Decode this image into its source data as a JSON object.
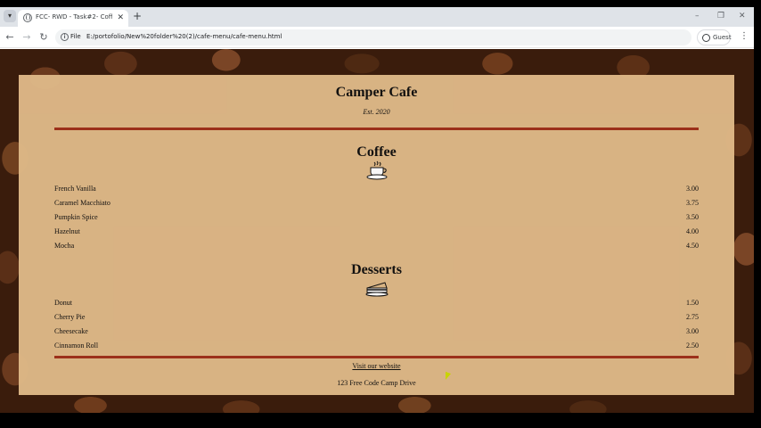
{
  "browser": {
    "tab_title": "FCC- RWD - Task#2- Coffie Sh…",
    "scheme": "File",
    "url": "E:/portofolio/New%20folder%20(2)/cafe-menu/cafe-menu.html",
    "profile_label": "Guest"
  },
  "menu": {
    "cafe_name": "Camper Cafe",
    "established": "Est. 2020",
    "sections": [
      {
        "title": "Coffee",
        "icon": "coffee-cup-icon",
        "items": [
          {
            "name": "French Vanilla",
            "price": "3.00"
          },
          {
            "name": "Caramel Macchiato",
            "price": "3.75"
          },
          {
            "name": "Pumpkin Spice",
            "price": "3.50"
          },
          {
            "name": "Hazelnut",
            "price": "4.00"
          },
          {
            "name": "Mocha",
            "price": "4.50"
          }
        ]
      },
      {
        "title": "Desserts",
        "icon": "pie-slice-icon",
        "items": [
          {
            "name": "Donut",
            "price": "1.50"
          },
          {
            "name": "Cherry Pie",
            "price": "2.75"
          },
          {
            "name": "Cheesecake",
            "price": "3.00"
          },
          {
            "name": "Cinnamon Roll",
            "price": "2.50"
          }
        ]
      }
    ],
    "footer_link": "Visit our website",
    "address": "123 Free Code Camp Drive"
  },
  "colors": {
    "menu_background": "#deb887",
    "divider": "#a0311b"
  }
}
